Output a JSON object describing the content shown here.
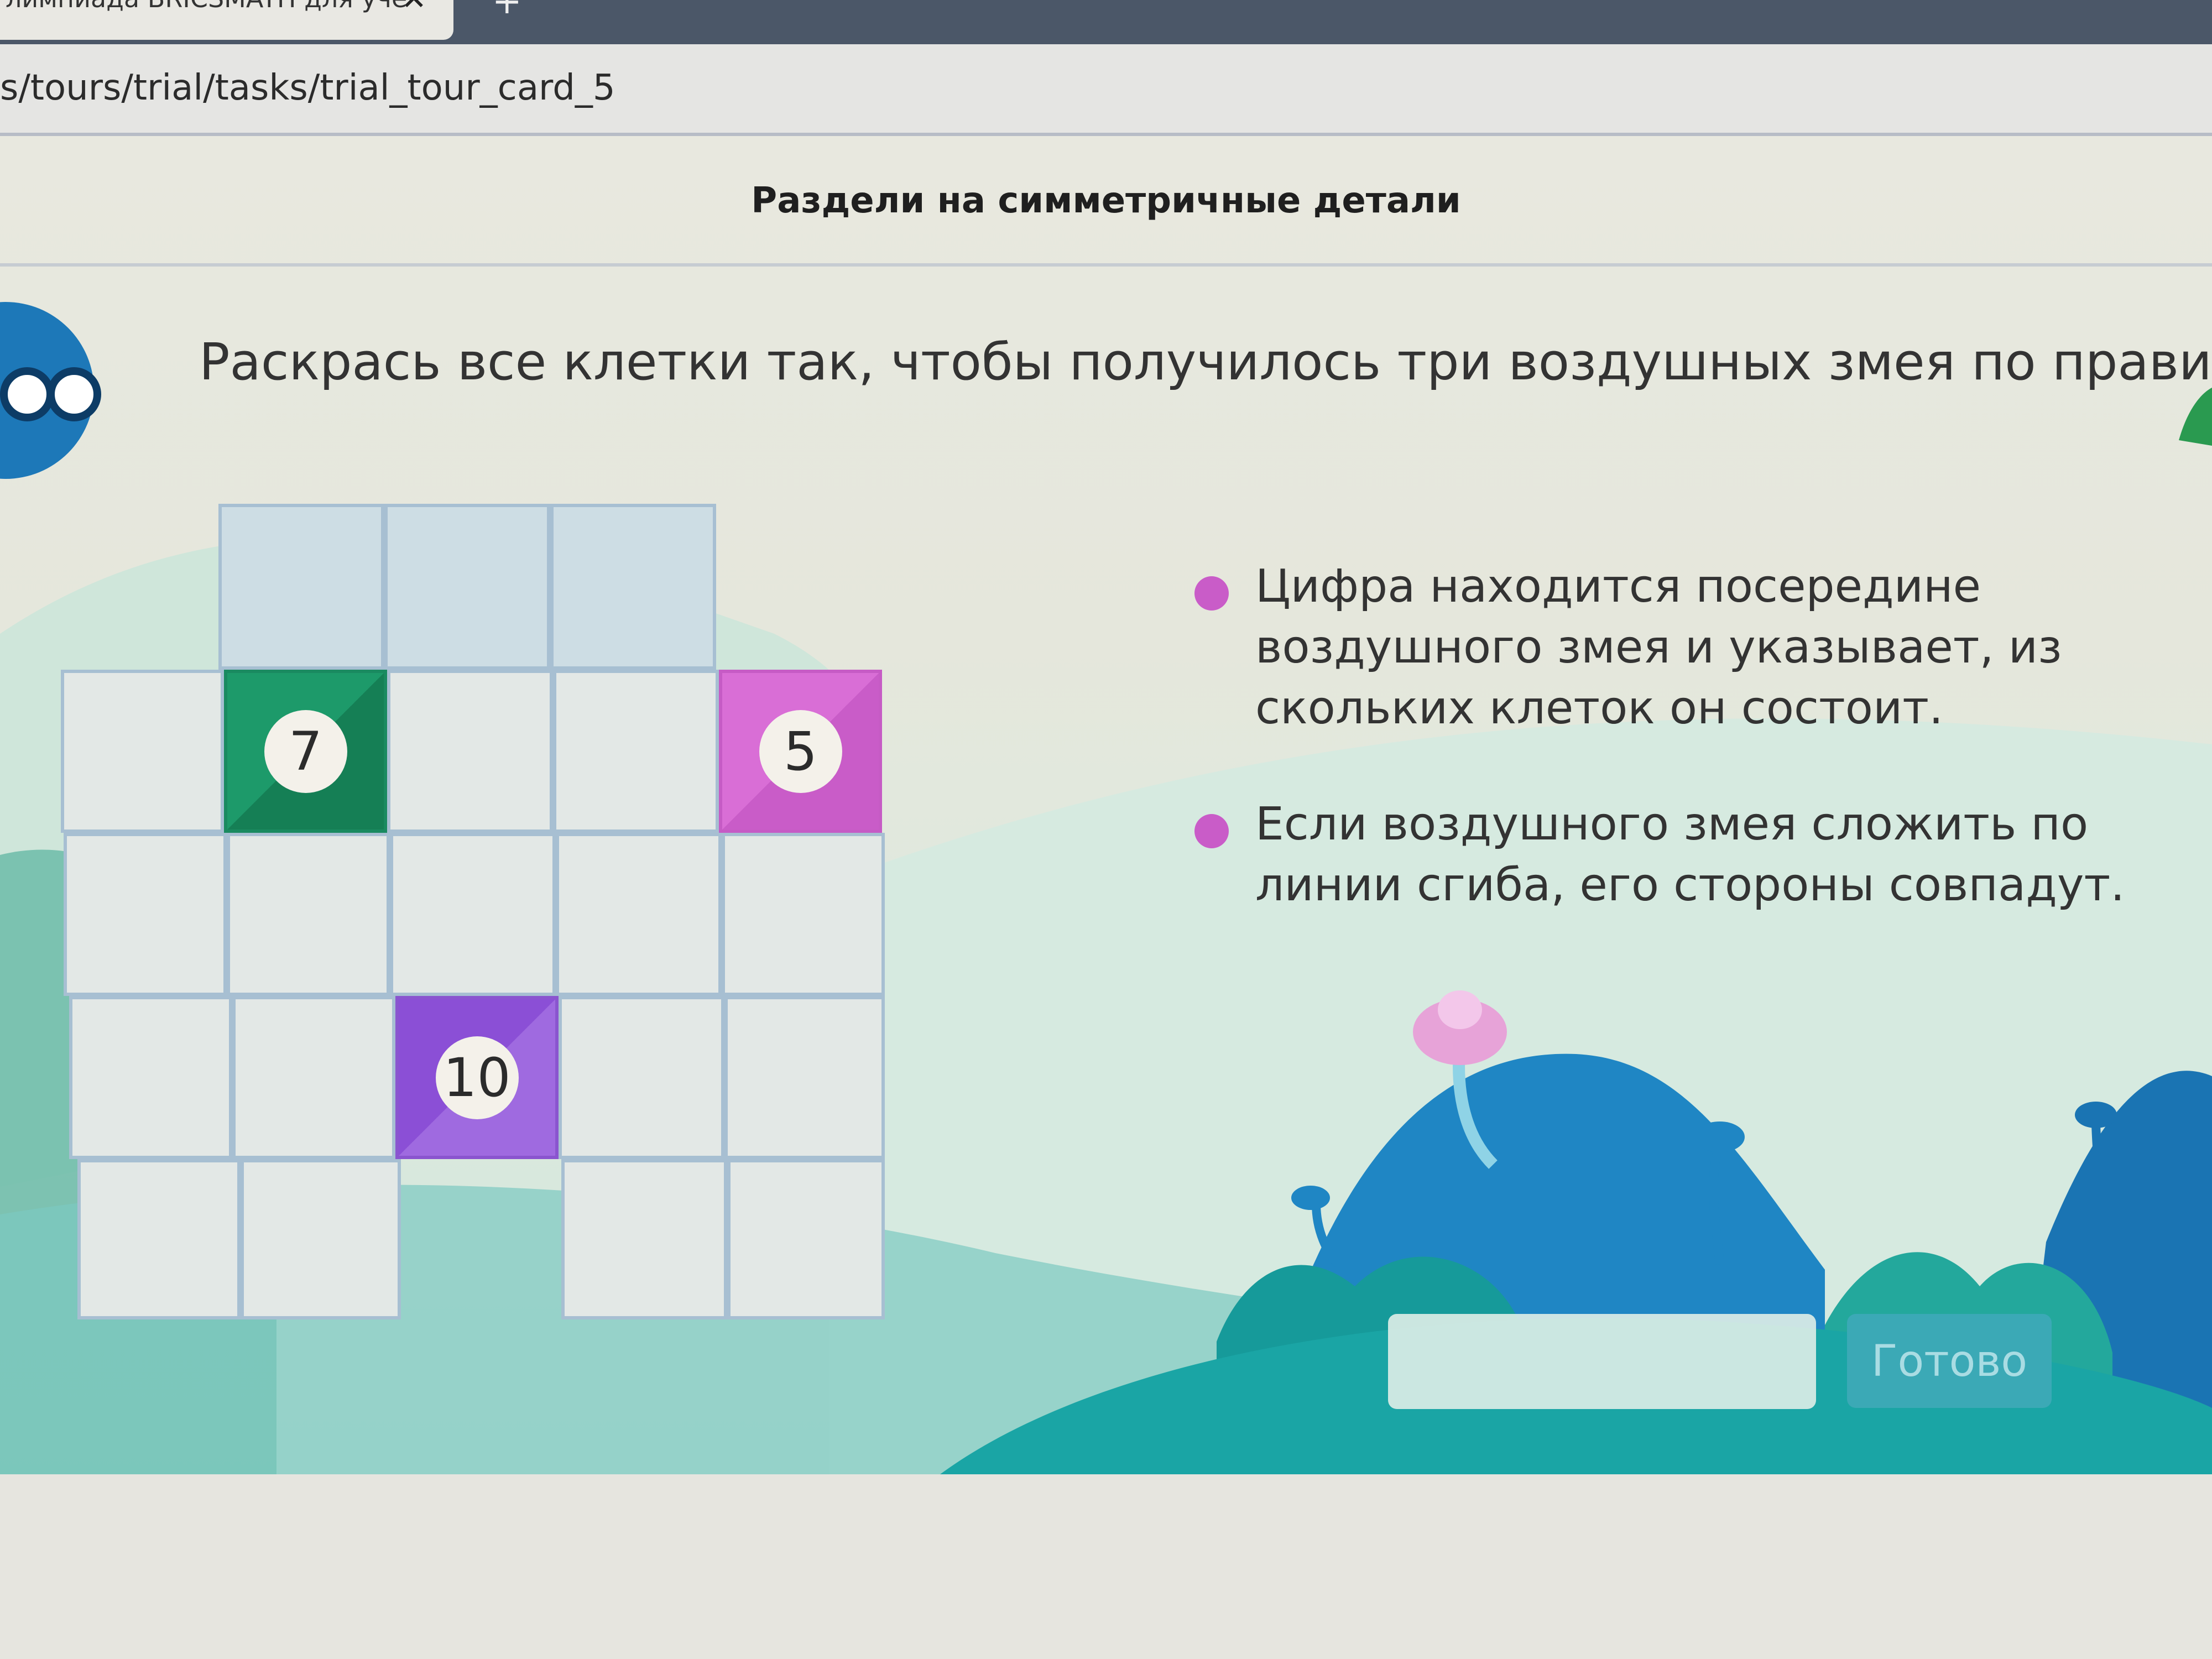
{
  "browser": {
    "tab_title": "лимпиада BRICSMATH для уче",
    "close_glyph": "✕",
    "new_tab_glyph": "+",
    "url": "s/tours/trial/tasks/trial_tour_card_5"
  },
  "page": {
    "header_title": "Раздели на симметричные детали",
    "task_text": "Раскрась все клетки так, чтобы получилось три воздушных змея по правилам:",
    "rules": [
      "Цифра находится посередине воздушного змея и указывает, из скольких клеток он состоит.",
      "Если воздушного змея сложить по линии сгиба, его стороны совпадут."
    ],
    "grid": {
      "numbers": [
        "7",
        "5",
        "10"
      ]
    },
    "answer_input_placeholder": "",
    "done_button_label": "Готово"
  },
  "colors": {
    "kite_7": "#1d9a6a",
    "kite_5": "#d96ed6",
    "kite_10": "#8b4fd6",
    "bullet": "#c95cc8",
    "button": "#3ba9b6"
  }
}
